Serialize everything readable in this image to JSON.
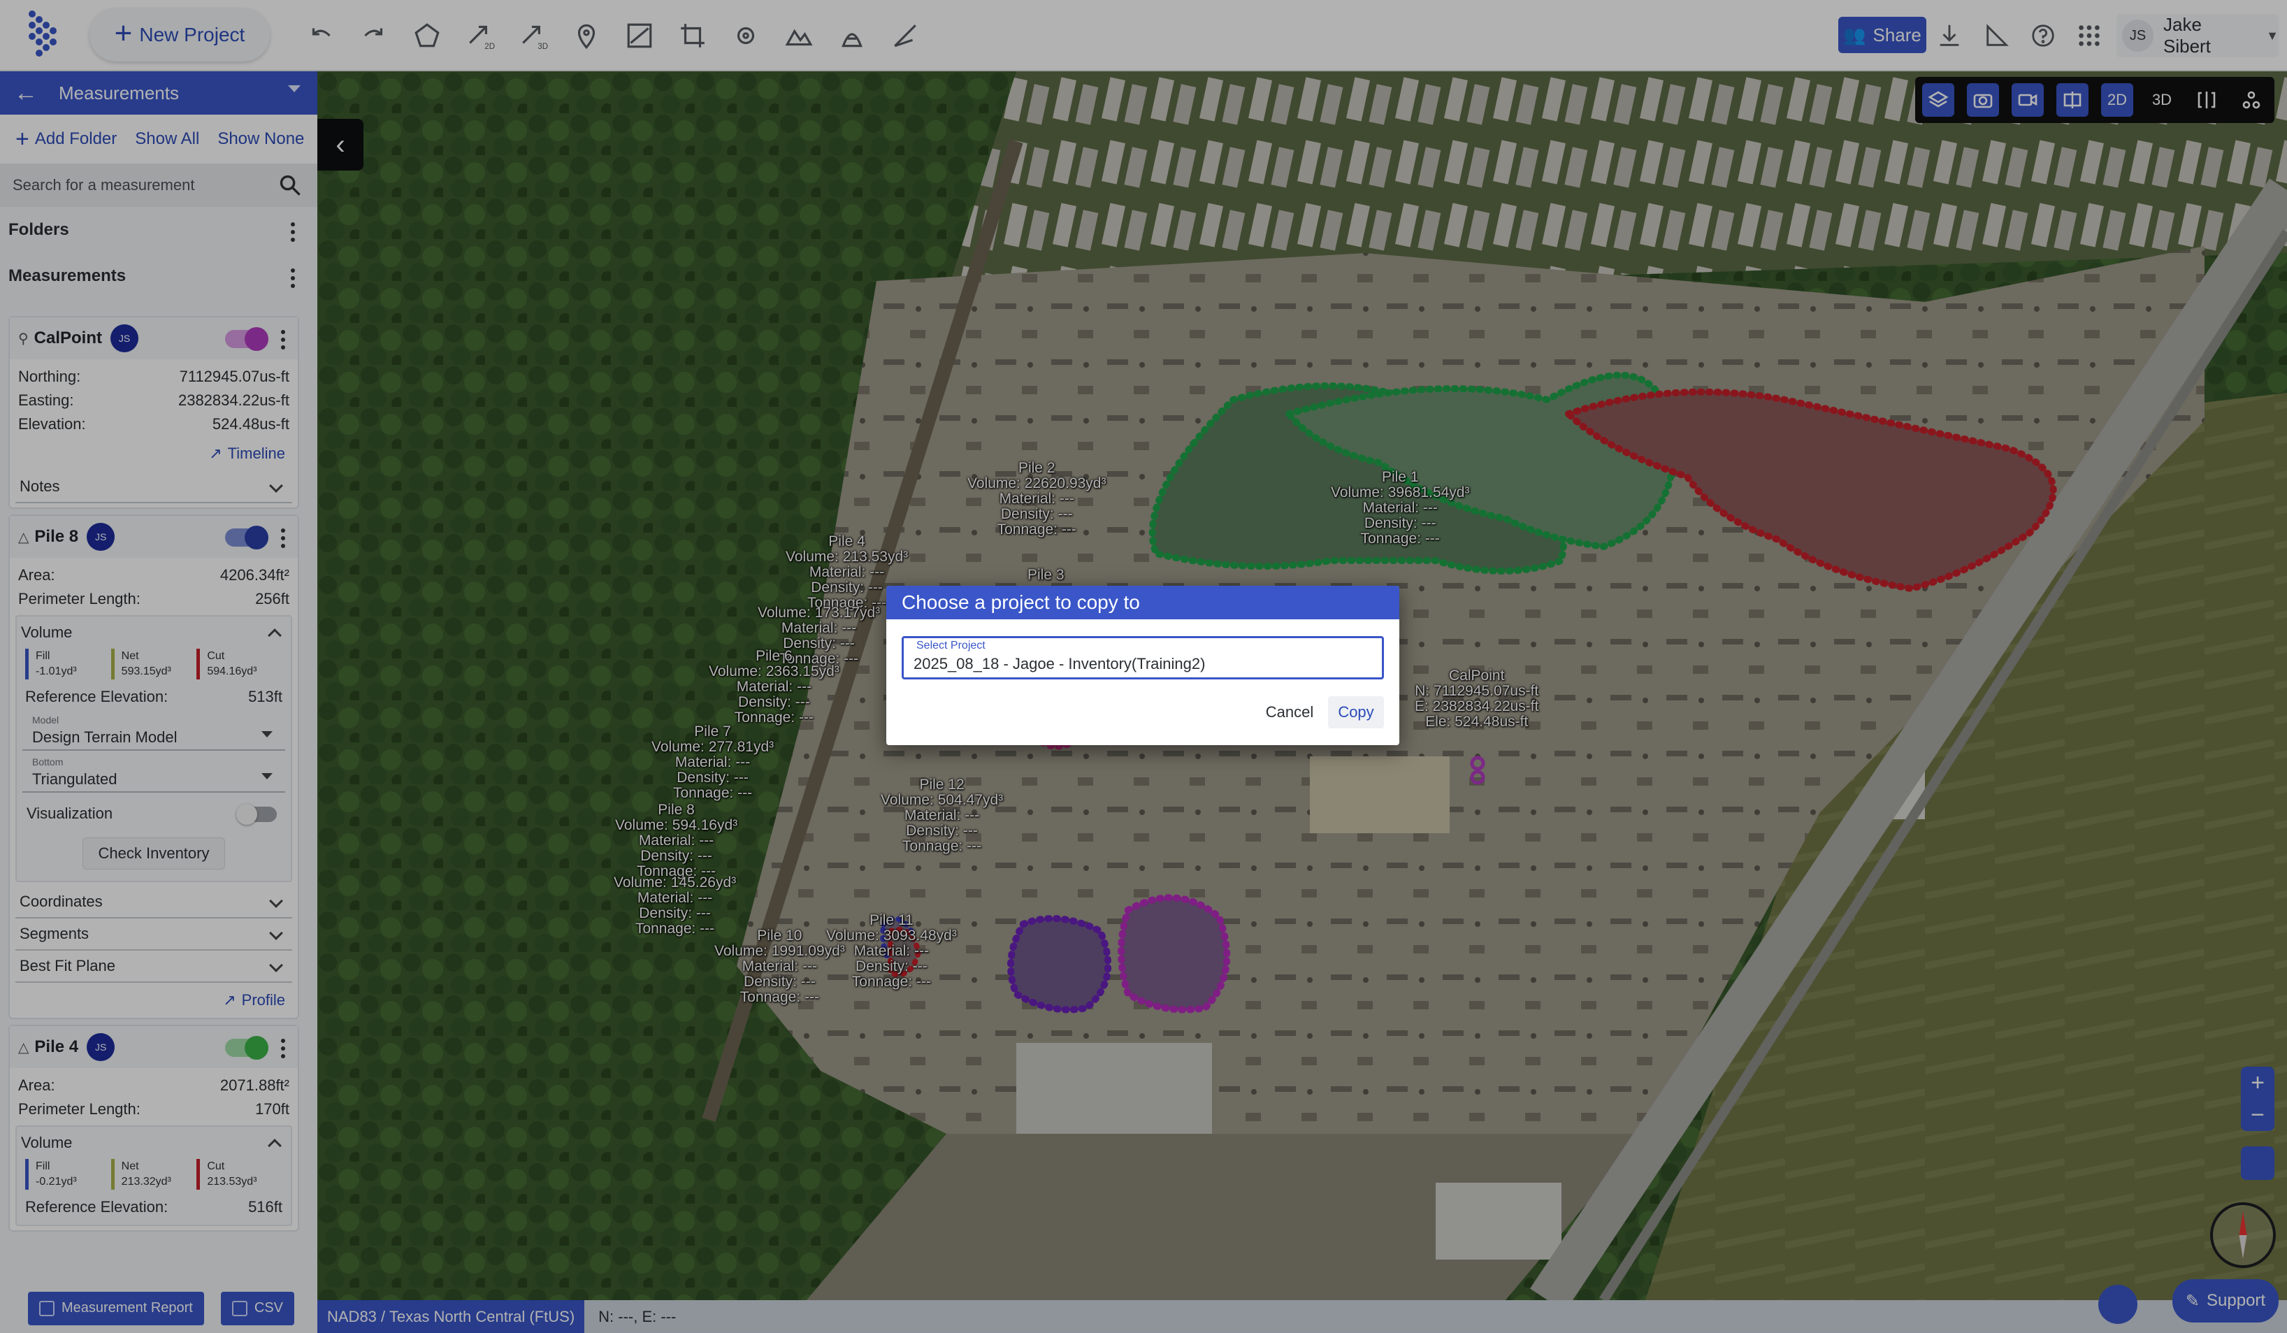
{
  "topbar": {
    "new_project_label": "New Project",
    "share_label": "Share",
    "user_initials": "JS",
    "user_name": "Jake Sibert"
  },
  "sidebar": {
    "header_title": "Measurements",
    "add_folder_label": "Add Folder",
    "show_all_label": "Show All",
    "show_none_label": "Show None",
    "search_placeholder": "Search for a measurement",
    "folders_label": "Folders",
    "measurements_label": "Measurements",
    "calpoint": {
      "name": "CalPoint",
      "badge": "JS",
      "northing_label": "Northing:",
      "northing": "7112945.07us-ft",
      "easting_label": "Easting:",
      "easting": "2382834.22us-ft",
      "elevation_label": "Elevation:",
      "elevation": "524.48us-ft",
      "timeline_label": "Timeline",
      "notes_label": "Notes",
      "toggle_color": "#b03bc0"
    },
    "pile8": {
      "name": "Pile 8",
      "badge": "JS",
      "area_label": "Area:",
      "area": "4206.34ft²",
      "perimeter_label": "Perimeter Length:",
      "perimeter": "256ft",
      "volume_label": "Volume",
      "fill_label": "Fill",
      "fill": "-1.01yd³",
      "net_label": "Net",
      "net": "593.15yd³",
      "cut_label": "Cut",
      "cut": "594.16yd³",
      "ref_elev_label": "Reference Elevation:",
      "ref_elev": "513ft",
      "model_label": "Model",
      "model_value": "Design Terrain Model",
      "bottom_label": "Bottom",
      "bottom_value": "Triangulated",
      "visualization_label": "Visualization",
      "check_inventory_label": "Check Inventory",
      "coordinates_label": "Coordinates",
      "segments_label": "Segments",
      "best_fit_label": "Best Fit Plane",
      "profile_label": "Profile",
      "toggle_color": "#2a3fa8"
    },
    "pile4": {
      "name": "Pile 4",
      "badge": "JS",
      "area_label": "Area:",
      "area": "2071.88ft²",
      "perimeter_label": "Perimeter Length:",
      "perimeter": "170ft",
      "volume_label": "Volume",
      "fill_label": "Fill",
      "fill": "-0.21yd³",
      "net_label": "Net",
      "net": "213.32yd³",
      "cut_label": "Cut",
      "cut": "213.53yd³",
      "ref_elev_label": "Reference Elevation:",
      "ref_elev": "516ft",
      "toggle_color": "#3bb34a"
    },
    "report_label": "Measurement Report",
    "csv_label": "CSV"
  },
  "map_controls": {
    "mode_2d": "2D",
    "mode_3d": "3D"
  },
  "map_labels": {
    "pile1": [
      "Pile 1",
      "Volume: 39681.54yd³",
      "Material: ---",
      "Density: ---",
      "Tonnage: ---"
    ],
    "pile2": [
      "Pile 2",
      "Volume: 22620.93yd³",
      "Material: ---",
      "Density: ---",
      "Tonnage: ---"
    ],
    "pile3": [
      "Pile 3"
    ],
    "pile4": [
      "Pile 4",
      "Volume: 213.53yd³",
      "Material: ---",
      "Density: ---",
      "Tonnage: ---"
    ],
    "pile5": [
      "Volume: 173.17yd³",
      "Material: ---",
      "Density: ---",
      "Tonnage: ---"
    ],
    "pile6": [
      "Pile 6",
      "Volume: 2363.15yd³",
      "Material: ---",
      "Density: ---",
      "Tonnage: ---"
    ],
    "pile7": [
      "Pile 7",
      "Volume: 277.81yd³",
      "Material: ---",
      "Density: ---",
      "Tonnage: ---"
    ],
    "pile8": [
      "Pile 8",
      "Volume: 594.16yd³",
      "Material: ---",
      "Density: ---",
      "Tonnage: ---"
    ],
    "pile9": [
      "Volume: 145.26yd³",
      "Material: ---",
      "Density: ---",
      "Tonnage: ---"
    ],
    "pile10": [
      "Pile 10",
      "Volume: 1991.09yd³",
      "Material: ---",
      "Density: ---",
      "Tonnage: ---"
    ],
    "pile11": [
      "Pile 11",
      "Volume: 3093.48yd³",
      "Material: ---",
      "Density: ---",
      "Tonnage: ---"
    ],
    "pile12": [
      "Pile 12",
      "Volume: 504.47yd³",
      "Material: ---",
      "Density: ---",
      "Tonnage: ---"
    ],
    "calpoint": [
      "CalPoint",
      "N: 7112945.07us-ft",
      "E: 2382834.22us-ft",
      "Ele: 524.48us-ft"
    ]
  },
  "status_bar": {
    "crs": "NAD83 / Texas North Central (FtUS)",
    "coords": "N: ---, E: ---"
  },
  "support_label": "Support",
  "dialog": {
    "title": "Choose a project to copy to",
    "field_label": "Select Project",
    "field_value": "2025_08_18 - Jagoe - Inventory(Training2)",
    "cancel_label": "Cancel",
    "copy_label": "Copy"
  }
}
